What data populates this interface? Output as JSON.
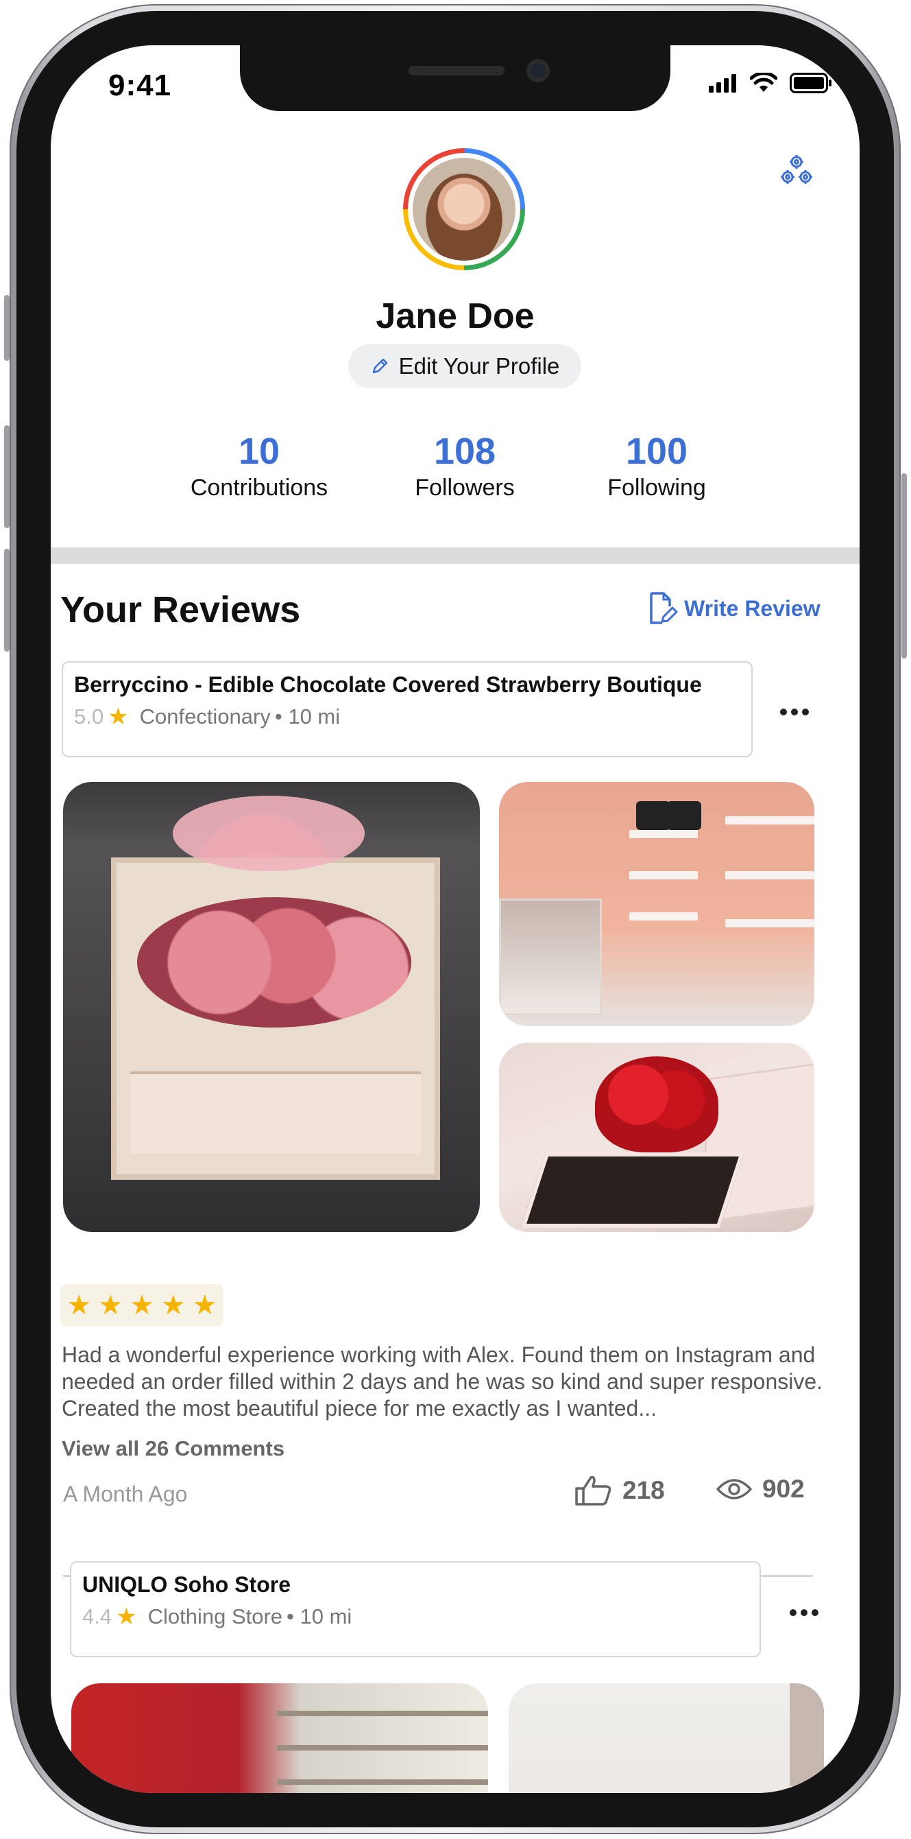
{
  "status_bar": {
    "time": "9:41"
  },
  "profile": {
    "name": "Jane Doe",
    "edit_label": "Edit Your Profile",
    "stats": [
      {
        "value": "10",
        "label": "Contributions"
      },
      {
        "value": "108",
        "label": "Followers"
      },
      {
        "value": "100",
        "label": "Following"
      }
    ]
  },
  "reviews_section": {
    "title": "Your Reviews",
    "write_review_label": "Write Review"
  },
  "reviews": [
    {
      "place_name": "Berryccino - Edible Chocolate Covered Strawberry Boutique",
      "rating": "5.0",
      "category": "Confectionary",
      "distance": "• 10 mi",
      "stars": 5,
      "text": "Had a wonderful experience working with Alex. Found them on Instagram and needed an order filled within 2 days and he was so kind and super responsive. Created the most beautiful piece for me exactly as I wanted...",
      "comments_label": "View all 26 Comments",
      "time_ago": "A Month Ago",
      "likes": "218",
      "views": "902"
    },
    {
      "place_name": "UNIQLO Soho Store",
      "rating": "4.4",
      "category": "Clothing Store",
      "distance": "• 10 mi"
    }
  ],
  "colors": {
    "accent": "#3c6fd6",
    "star": "#f5b400",
    "divider": "#dcdcdc"
  }
}
